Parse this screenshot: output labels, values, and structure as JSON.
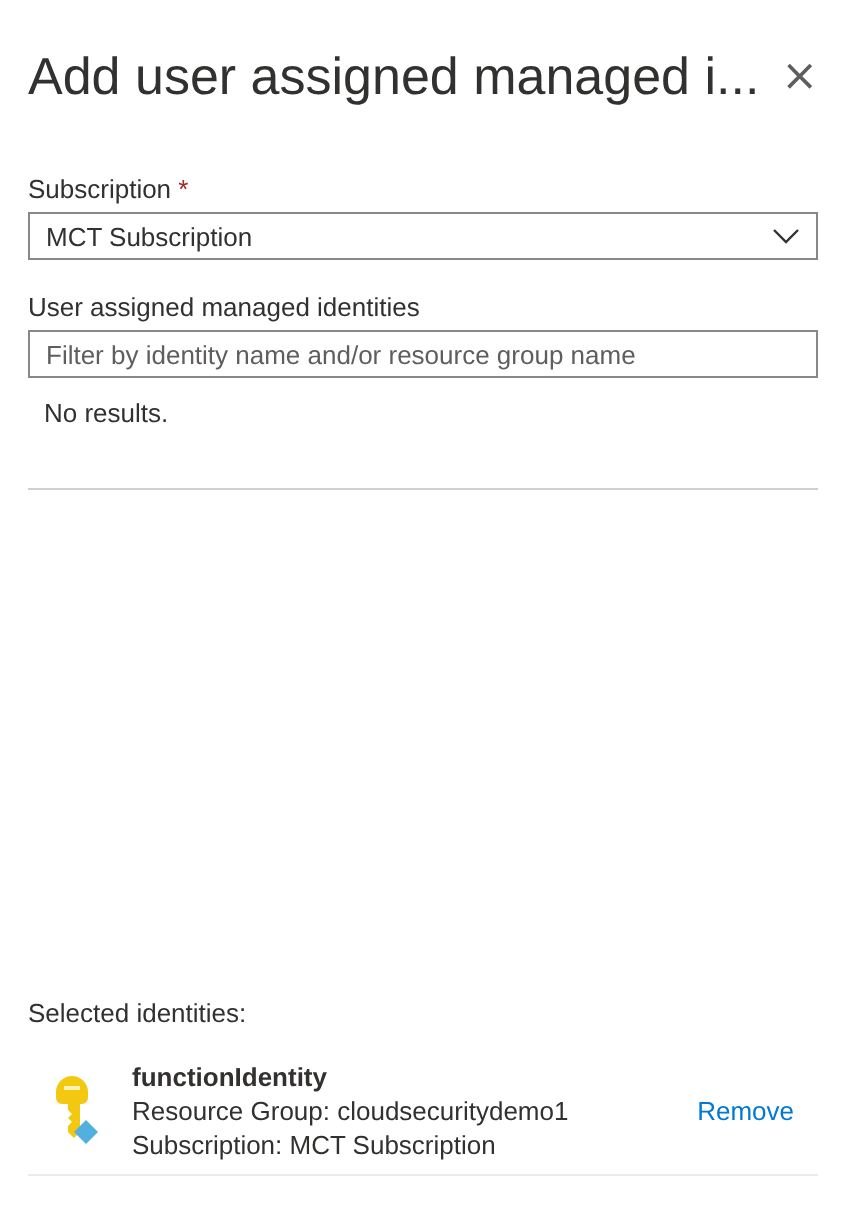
{
  "panel": {
    "title": "Add user assigned managed i...",
    "close": "×"
  },
  "subscription": {
    "label": "Subscription",
    "required": true,
    "required_mark": "*",
    "value": "MCT Subscription"
  },
  "identities": {
    "label": "User assigned managed identities",
    "placeholder": "Filter by identity name and/or resource group name",
    "empty_text": "No results."
  },
  "selected": {
    "heading": "Selected identities:",
    "items": [
      {
        "name": "functionIdentity",
        "resource_group": "Resource Group: cloudsecuritydemo1",
        "subscription": "Subscription: MCT Subscription",
        "action": "Remove"
      }
    ]
  }
}
